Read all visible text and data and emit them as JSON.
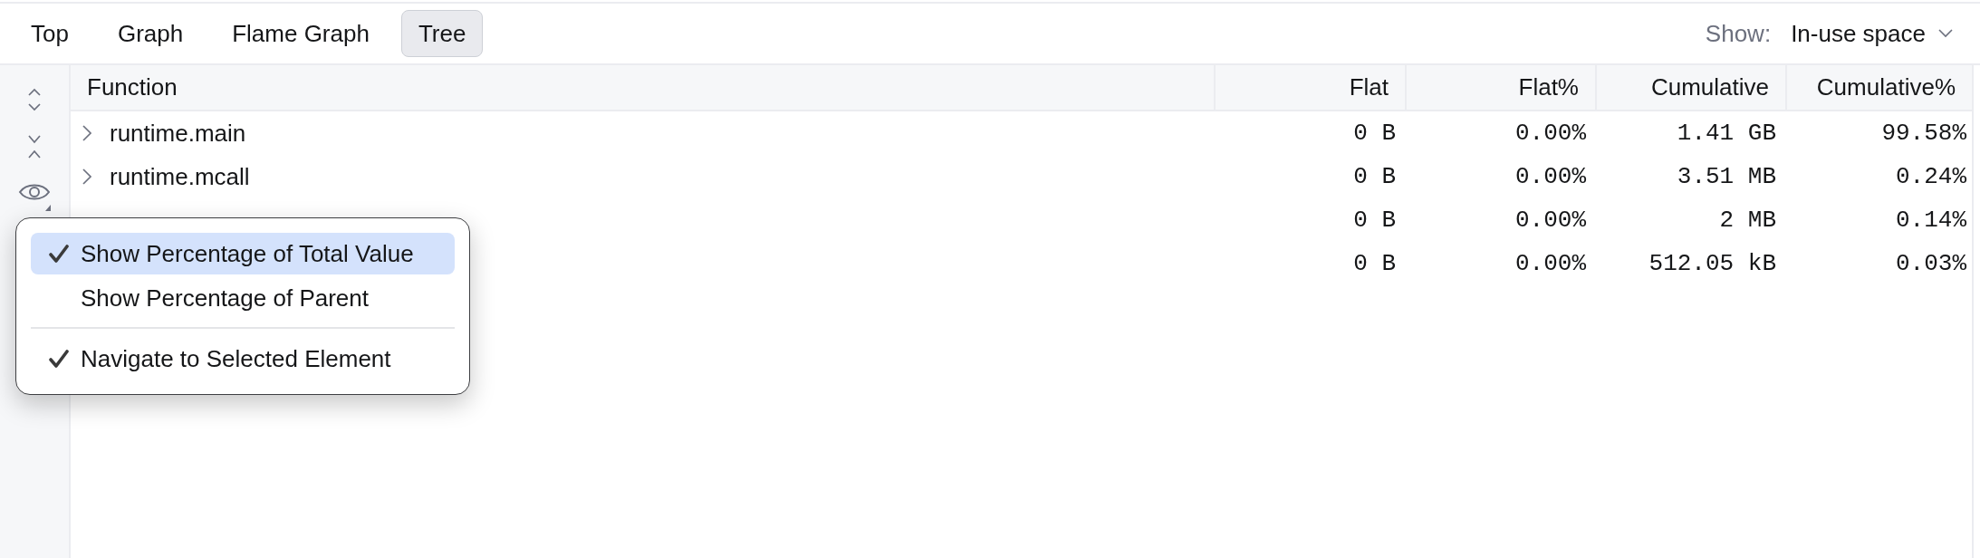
{
  "toolbar": {
    "tabs": [
      {
        "label": "Top",
        "selected": false
      },
      {
        "label": "Graph",
        "selected": false
      },
      {
        "label": "Flame Graph",
        "selected": false
      },
      {
        "label": "Tree",
        "selected": true
      }
    ],
    "show": {
      "label": "Show:",
      "value": "In-use space"
    }
  },
  "table": {
    "columns": [
      "Function",
      "Flat",
      "Flat%",
      "Cumulative",
      "Cumulative%"
    ],
    "rows": [
      {
        "function": "runtime.main",
        "expanded": false,
        "values": [
          "0 B",
          "0.00%",
          "1.41 GB",
          "99.58%"
        ]
      },
      {
        "function": "runtime.mcall",
        "expanded": false,
        "values": [
          "0 B",
          "0.00%",
          "3.51 MB",
          "0.24%"
        ]
      },
      {
        "values": [
          "0 B",
          "0.00%",
          "2 MB",
          "0.14%"
        ]
      },
      {
        "values": [
          "0 B",
          "0.00%",
          "512.05 kB",
          "0.03%"
        ]
      }
    ]
  },
  "menu": {
    "sections": [
      {
        "items": [
          {
            "label": "Show Percentage of Total Value",
            "checked": true,
            "selected": true
          },
          {
            "label": "Show Percentage of Parent",
            "checked": false,
            "selected": false
          }
        ]
      },
      {
        "items": [
          {
            "label": "Navigate to Selected Element",
            "checked": true,
            "selected": false
          }
        ]
      }
    ]
  }
}
